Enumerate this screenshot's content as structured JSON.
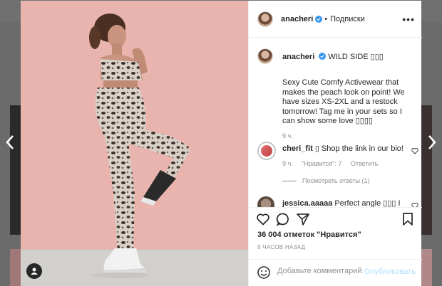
{
  "post": {
    "author": "anacheri",
    "follow_label": "Подписки",
    "more_label": "•••",
    "caption_first_line": "WILD SIDE ▯▯▯",
    "caption_body": "Sexy Cute Comfy Activewear that makes the peach look on point! We have sizes XS-2XL and a restock tomorrow! Tag me in your sets so I can show some love ▯▯▯▯",
    "caption_time": "9 ч.",
    "comments": [
      {
        "author": "cheri_fit",
        "text": "▯ Shop the link in our bio!",
        "time": "9 ч.",
        "likes_label": "\"Нравится\": 7",
        "reply_label": "Ответить",
        "view_replies": "Посмотреть ответы (1)"
      },
      {
        "author": "jessica.aaaaa",
        "text": "Perfect angle ▯▯▯ I"
      }
    ],
    "likes_text": "36 004 отметок \"Нравится\"",
    "posted_ago": "9 ЧАСОВ НАЗАД",
    "comment_placeholder": "Добавьте комментарий...",
    "publish_label": "Опубликовать"
  },
  "icons": {
    "prev": "chevron-left-icon",
    "next": "chevron-right-icon",
    "verified": "verified-badge-icon",
    "like": "heart-icon",
    "comment": "comment-icon",
    "share": "share-icon",
    "save": "bookmark-icon",
    "emoji": "emoji-icon",
    "tag": "user-tag-icon"
  },
  "colors": {
    "verified": "#3897f0",
    "link_disabled": "#b2dffc",
    "muted": "#8e8e8e",
    "wall": "#e9b3ae",
    "floor": "#d2d0cd"
  }
}
